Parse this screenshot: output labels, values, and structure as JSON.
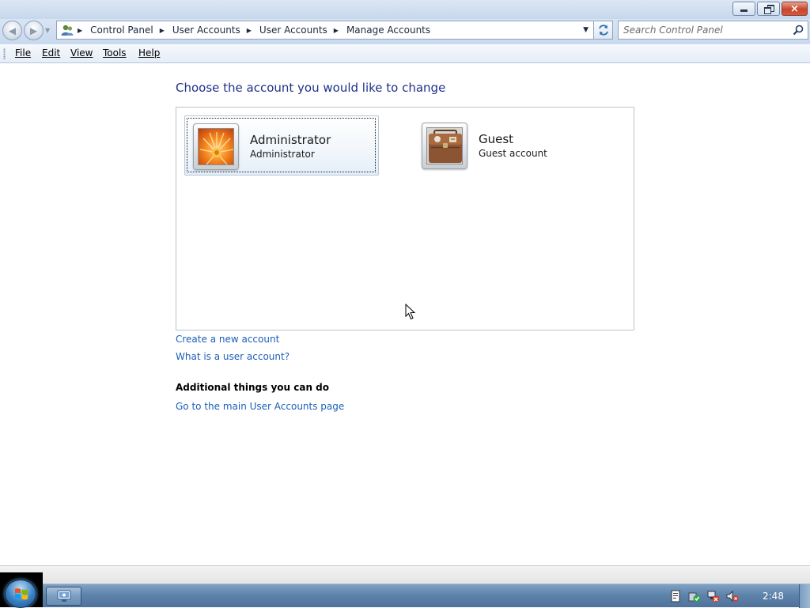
{
  "window": {
    "minimize_icon": "minimize-icon",
    "maximize_icon": "restore-icon",
    "close_label": "×"
  },
  "navigation": {
    "back_glyph": "◀",
    "forward_glyph": "▶",
    "breadcrumbs": [
      "Control Panel",
      "User Accounts",
      "User Accounts",
      "Manage Accounts"
    ],
    "search_placeholder": "Search Control Panel"
  },
  "menu": {
    "file": "File",
    "edit": "Edit",
    "view": "View",
    "tools": "Tools",
    "help": "Help"
  },
  "main": {
    "heading": "Choose the account you would like to change",
    "accounts": [
      {
        "name": "Administrator",
        "type": "Administrator",
        "picture": "orange-flower"
      },
      {
        "name": "Guest",
        "type": "Guest account",
        "picture": "brown-suitcase"
      }
    ],
    "links": {
      "create": "Create a new account",
      "what_is": "What is a user account?"
    },
    "additional_heading": "Additional things you can do",
    "additional_links": [
      "Go to the main User Accounts page"
    ]
  },
  "taskbar": {
    "clock": "2:48",
    "tray_icons": [
      "document-icon",
      "security-check-icon",
      "network-error-icon",
      "volume-muted-icon"
    ]
  },
  "colors": {
    "heading": "#1e3287",
    "link": "#1c5fb8",
    "title_bar": "#c7d7ec",
    "close_button": "#c8452c",
    "taskbar": "#5f84ab"
  }
}
